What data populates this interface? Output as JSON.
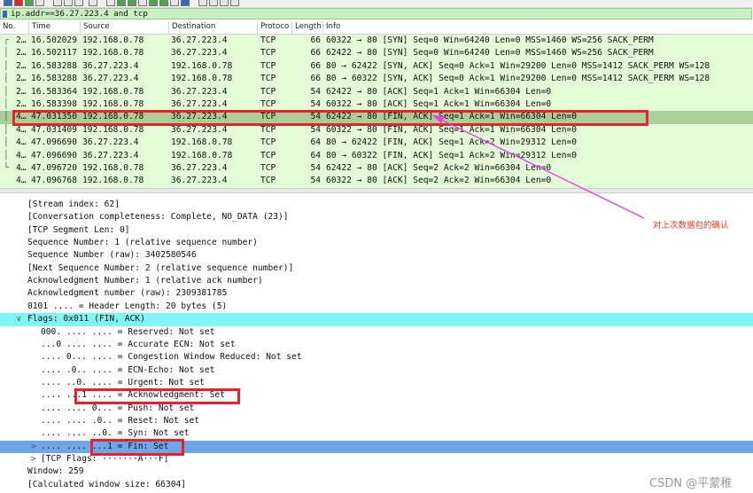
{
  "filter": {
    "text": "ip.addr==36.27.223.4 and tcp"
  },
  "columns": [
    "No.",
    "Time",
    "Source",
    "Destination",
    "Protocol",
    "Length",
    "Info"
  ],
  "packets": [
    {
      "no": "2…",
      "time": "16.502029",
      "src": "192.168.0.78",
      "dst": "36.27.223.4",
      "proto": "TCP",
      "len": "66",
      "info": "60322 → 80 [SYN] Seq=0 Win=64240 Len=0 MSS=1460 WS=256 SACK_PERM",
      "tree": "┌"
    },
    {
      "no": "2…",
      "time": "16.502117",
      "src": "192.168.0.78",
      "dst": "36.27.223.4",
      "proto": "TCP",
      "len": "66",
      "info": "62422 → 80 [SYN] Seq=0 Win=64240 Len=0 MSS=1460 WS=256 SACK_PERM",
      "tree": "│"
    },
    {
      "no": "2…",
      "time": "16.583288",
      "src": "36.27.223.4",
      "dst": "192.168.0.78",
      "proto": "TCP",
      "len": "66",
      "info": "80 → 62422 [SYN, ACK] Seq=0 Ack=1 Win=29200 Len=0 MSS=1412 SACK_PERM WS=128",
      "tree": "│"
    },
    {
      "no": "2…",
      "time": "16.583288",
      "src": "36.27.223.4",
      "dst": "192.168.0.78",
      "proto": "TCP",
      "len": "66",
      "info": "80 → 60322 [SYN, ACK] Seq=0 Ack=1 Win=29200 Len=0 MSS=1412 SACK_PERM WS=128",
      "tree": "│"
    },
    {
      "no": "2…",
      "time": "16.583364",
      "src": "192.168.0.78",
      "dst": "36.27.223.4",
      "proto": "TCP",
      "len": "54",
      "info": "62422 → 80 [ACK] Seq=1 Ack=1 Win=66304 Len=0",
      "tree": "│"
    },
    {
      "no": "2…",
      "time": "16.583398",
      "src": "192.168.0.78",
      "dst": "36.27.223.4",
      "proto": "TCP",
      "len": "54",
      "info": "60322 → 80 [ACK] Seq=1 Ack=1 Win=66304 Len=0",
      "tree": "│"
    },
    {
      "no": "4…",
      "time": "47.031350",
      "src": "192.168.0.78",
      "dst": "36.27.223.4",
      "proto": "TCP",
      "len": "54",
      "info": "62422 → 80 [FIN, ACK] Seq=1 Ack=1 Win=66304 Len=0",
      "tree": "│"
    },
    {
      "no": "4…",
      "time": "47.031409",
      "src": "192.168.0.78",
      "dst": "36.27.223.4",
      "proto": "TCP",
      "len": "54",
      "info": "60322 → 80 [FIN, ACK] Seq=1 Ack=1 Win=66304 Len=0",
      "tree": "│"
    },
    {
      "no": "4…",
      "time": "47.096690",
      "src": "36.27.223.4",
      "dst": "192.168.0.78",
      "proto": "TCP",
      "len": "64",
      "info": "80 → 62422 [FIN, ACK] Seq=1 Ack=2 Win=29312 Len=0",
      "tree": "│"
    },
    {
      "no": "4…",
      "time": "47.096690",
      "src": "36.27.223.4",
      "dst": "192.168.0.78",
      "proto": "TCP",
      "len": "64",
      "info": "80 → 60322 [FIN, ACK] Seq=1 Ack=2 Win=29312 Len=0",
      "tree": "│"
    },
    {
      "no": "4…",
      "time": "47.096720",
      "src": "192.168.0.78",
      "dst": "36.27.223.4",
      "proto": "TCP",
      "len": "54",
      "info": "62422 → 80 [ACK] Seq=2 Ack=2 Win=66304 Len=0",
      "tree": "└"
    },
    {
      "no": "4…",
      "time": "47.096768",
      "src": "192.168.0.78",
      "dst": "36.27.223.4",
      "proto": "TCP",
      "len": "54",
      "info": "60322 → 80 [ACK] Seq=2 Ack=2 Win=66304 Len=0",
      "tree": ""
    }
  ],
  "selected_packet_index": 6,
  "details": [
    {
      "text": "[Stream index: 62]",
      "indent": 0
    },
    {
      "text": "[Conversation completeness: Complete, NO_DATA (23)]",
      "indent": 0
    },
    {
      "text": "[TCP Segment Len: 0]",
      "indent": 0
    },
    {
      "text": "Sequence Number: 1    (relative sequence number)",
      "indent": 0
    },
    {
      "text": "Sequence Number (raw): 3402580546",
      "indent": 0
    },
    {
      "text": "[Next Sequence Number: 2    (relative sequence number)]",
      "indent": 0
    },
    {
      "text": "Acknowledgment Number: 1    (relative ack number)",
      "indent": 0
    },
    {
      "text": "Acknowledgment number (raw): 2309381785",
      "indent": 0
    },
    {
      "text": "0101 .... = Header Length: 20 bytes (5)",
      "indent": 0
    },
    {
      "text": "Flags: 0x011 (FIN, ACK)",
      "indent": 0,
      "arrow": "∨",
      "style": "cyan"
    },
    {
      "text": "000. .... .... = Reserved: Not set",
      "indent": 1
    },
    {
      "text": "...0 .... .... = Accurate ECN: Not set",
      "indent": 1
    },
    {
      "text": ".... 0... .... = Congestion Window Reduced: Not set",
      "indent": 1
    },
    {
      "text": ".... .0.. .... = ECN-Echo: Not set",
      "indent": 1
    },
    {
      "text": ".... ..0. .... = Urgent: Not set",
      "indent": 1
    },
    {
      "text": ".... ...1 .... = Acknowledgment: Set",
      "indent": 1
    },
    {
      "text": ".... .... 0... = Push: Not set",
      "indent": 1
    },
    {
      "text": ".... .... .0.. = Reset: Not set",
      "indent": 1
    },
    {
      "text": ".... .... ..0. = Syn: Not set",
      "indent": 1
    },
    {
      "text": ".... .... ...1 = Fin: Set",
      "indent": 1,
      "arrow": ">",
      "style": "blue"
    },
    {
      "text": "[TCP Flags: ·······A···F]",
      "indent": 1,
      "arrow": ">"
    },
    {
      "text": "Window: 259",
      "indent": 0
    },
    {
      "text": "[Calculated window size: 66304]",
      "indent": 0
    }
  ],
  "annotation": "对上次数据包的确认",
  "watermark": "CSDN @平蒙稚",
  "colors": {
    "row_bg": "#e4fbd8",
    "row_selected": "#a9cf96",
    "flags_bg": "#7ff5f5",
    "fin_bg": "#6ea6ea",
    "highlight": "#e8222b",
    "arrow": "#e83ee8"
  }
}
